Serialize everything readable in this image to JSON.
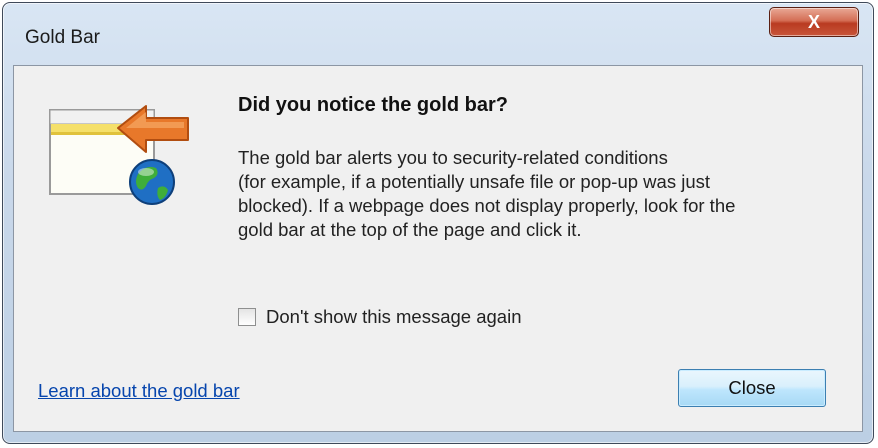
{
  "window": {
    "title": "Gold Bar",
    "close_glyph": "X"
  },
  "dialog": {
    "heading": "Did you notice the gold bar?",
    "body": "The gold bar alerts you to security-related conditions\n(for example, if a potentially unsafe file or pop-up was just\nblocked). If a webpage does not display properly, look for the\ngold bar at the top of the page and click it.",
    "checkbox": {
      "label": "Don't show this message again",
      "checked": false
    },
    "learn_link": "Learn about the gold bar",
    "close_button": "Close"
  },
  "icons": {
    "illustration": "browser-gold-bar-icon",
    "arrow": "orange-arrow-icon",
    "globe": "globe-icon"
  },
  "colors": {
    "gold_bar": "#f5e06a",
    "arrow": "#e8782a",
    "link": "#0645ad"
  }
}
